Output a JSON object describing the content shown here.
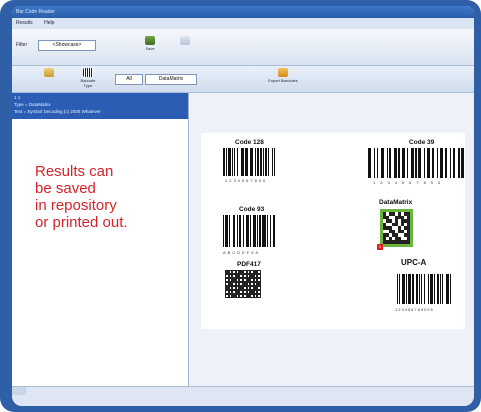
{
  "window": {
    "title": "Bar Code Reader",
    "menu": [
      "Results",
      "Help"
    ]
  },
  "toolbar": {
    "filter_label": "Filter",
    "filter_value": "<Showcase>",
    "save_label": "Save",
    "barcode_type_label": "Barcode Type",
    "barcode_type_value": "All",
    "data_value": "DataMatrix",
    "export_label": "Export Barcodes"
  },
  "results_list": [
    "1 1",
    "Type = DataMatrix",
    "Text = Symbol Decoding (c) 2005 Whatever"
  ],
  "promo": {
    "lines": [
      "Results can",
      "be saved",
      "in repository",
      "or printed out."
    ]
  },
  "sheet": {
    "code128": {
      "title": "Code 128",
      "digits": "1234567890"
    },
    "code39": {
      "title": "Code 39",
      "digits": "1234567890"
    },
    "code93": {
      "title": "Code 93",
      "digits": "ABCDEF98"
    },
    "datamatrix": {
      "title": "DataMatrix",
      "badge": "1"
    },
    "pdf417": {
      "title": "PDF417"
    },
    "upca": {
      "title": "UPC-A",
      "digits": "123456789005"
    }
  },
  "colors": {
    "frame": "#2e5fa7",
    "promo_text": "#d4242b",
    "selection": "#2a5db3",
    "datamatrix_border": "#69b33f"
  }
}
